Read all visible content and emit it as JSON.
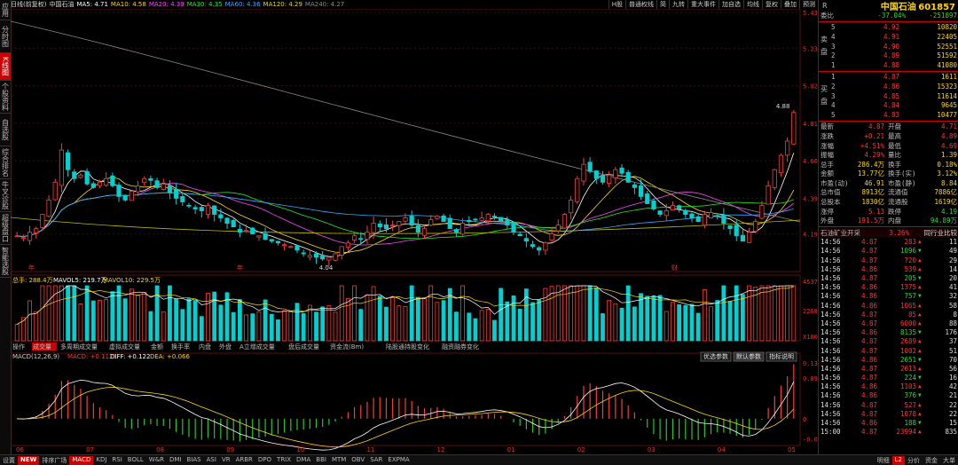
{
  "left_tabs": [
    "应用",
    "分时图",
    "K线图",
    "个股资料",
    "自选股",
    "综合排名",
    "牛叉诊股",
    "超级盘口",
    "智能选股"
  ],
  "header": {
    "period_label": "日线(前复权)",
    "stock_label": "中国石油",
    "ma": [
      {
        "label": "MA5: 4.71",
        "color": "#ffffff"
      },
      {
        "label": "MA10: 4.58",
        "color": "#ffd700"
      },
      {
        "label": "MA20: 4.39",
        "color": "#ff44ff"
      },
      {
        "label": "MA30: 4.35",
        "color": "#22ee22"
      },
      {
        "label": "MA60: 4.36",
        "color": "#33aaff"
      },
      {
        "label": "MA120: 4.29",
        "color": "#dddd00"
      },
      {
        "label": "MA240: 4.27",
        "color": "#888888"
      }
    ],
    "tools": [
      "H股",
      "普通权线",
      "简",
      "九转",
      "重大事件",
      "加自选",
      "均线",
      "复权",
      "叠加",
      "预测"
    ]
  },
  "price_axis": [
    "5.43",
    "5.23",
    "5.02",
    "4.81",
    "4.60",
    "4.39",
    "4.19"
  ],
  "price_annotations": {
    "high": "4.88",
    "low": "4.04"
  },
  "volume_axis": {
    "top": "45370",
    "mid": "22685",
    "unit": "X100"
  },
  "volume_legend": {
    "label": "总手: 288.4万",
    "mavol5": "MAVOL5: 219.7万",
    "mavol10": "MAVOL10: 229.5万"
  },
  "sub_tabs": [
    "操作",
    "成交量",
    "多周期成交量",
    "虚拟成交量",
    "金额",
    "换手率",
    "内盘",
    "外盘",
    "A立增成交量",
    "盘后成交量",
    "资金流(Bm)",
    "陆股通持股变化",
    "融资融券变化"
  ],
  "macd_legend": {
    "label": "MACD(12,26,9)",
    "macd": "MACD: +0.1121",
    "diff": "DIFF: +0.122",
    "dea": "DEA: +0.066"
  },
  "macd_buttons": [
    "优选参数",
    "默认参数",
    "指标说明"
  ],
  "macd_axis": [
    "0.134",
    "0.097",
    "0",
    "-0.048"
  ],
  "time_axis": [
    "06",
    "07",
    "08",
    "09",
    "10",
    "11",
    "12",
    "01",
    "02",
    "03",
    "04",
    "05"
  ],
  "month_markers": [
    "年",
    "年",
    "财"
  ],
  "bottom_tabs": [
    "设置",
    "NEW",
    "排序广场",
    "MACD",
    "KDJ",
    "RSI",
    "BOLL",
    "W&R",
    "DMI",
    "BIAS",
    "ASI",
    "VR",
    "ARBR",
    "DPO",
    "TRIX",
    "DMA",
    "BBI",
    "MTM",
    "OBV",
    "SAR",
    "EXPMA"
  ],
  "bottom_right_tabs": [
    "明细",
    "L2",
    "分价",
    "资金",
    "大单"
  ],
  "stock": {
    "name": "中国石油",
    "code": "601857",
    "badge": "R"
  },
  "weibi": {
    "label": "委比",
    "pct": "-37.04%",
    "diff": "-251897"
  },
  "sell_orders": [
    {
      "level": "5",
      "price": "4.92",
      "vol": "10820"
    },
    {
      "level": "4",
      "price": "4.91",
      "vol": "22405"
    },
    {
      "level": "3",
      "price": "4.90",
      "vol": "52551"
    },
    {
      "level": "2",
      "price": "4.89",
      "vol": "51592"
    },
    {
      "level": "1",
      "price": "4.88",
      "vol": "41080"
    }
  ],
  "buy_orders": [
    {
      "level": "1",
      "price": "4.87",
      "vol": "1611"
    },
    {
      "level": "2",
      "price": "4.86",
      "vol": "15323"
    },
    {
      "level": "3",
      "price": "4.85",
      "vol": "11614"
    },
    {
      "level": "4",
      "price": "4.84",
      "vol": "9645"
    },
    {
      "level": "5",
      "price": "4.83",
      "vol": "10477"
    }
  ],
  "sell_side_label": "卖盘",
  "buy_side_label": "买盘",
  "quote": [
    [
      "最新",
      "4.87",
      "开盘",
      "4.71"
    ],
    [
      "涨跌",
      "+0.21",
      "最高",
      "4.89"
    ],
    [
      "涨幅",
      "+4.51%",
      "最低",
      "4.69"
    ],
    [
      "振幅",
      "4.29%",
      "量比",
      "1.39"
    ],
    [
      "总手",
      "286.4万",
      "换手",
      "0.18%"
    ],
    [
      "金额",
      "13.77亿",
      "换手(实)",
      "3.12%"
    ],
    [
      "市盈(动)",
      "46.91",
      "市盈(静)",
      "8.84"
    ],
    [
      "总市值",
      "8913亿",
      "流通值",
      "7886亿"
    ],
    [
      "总股本",
      "1830亿",
      "流通股",
      "1619亿"
    ],
    [
      "涨停",
      "5.13",
      "跌停",
      "4.19"
    ],
    [
      "外盘",
      "191.5万",
      "内盘",
      "94.89万"
    ]
  ],
  "industry": {
    "label": "石油矿业开采",
    "pct": "3.26%",
    "link": "同行业比较"
  },
  "ticks": [
    [
      "14:56",
      "4.87",
      "283",
      "11"
    ],
    [
      "14:56",
      "4.87",
      "1096",
      "49"
    ],
    [
      "14:56",
      "4.87",
      "720",
      "29"
    ],
    [
      "14:56",
      "4.86",
      "539",
      "14"
    ],
    [
      "14:56",
      "4.87",
      "205",
      "20"
    ],
    [
      "14:56",
      "4.86",
      "1375",
      "41"
    ],
    [
      "14:56",
      "4.86",
      "757",
      "32"
    ],
    [
      "14:56",
      "4.86",
      "1065",
      "58"
    ],
    [
      "14:56",
      "4.87",
      "85",
      "8"
    ],
    [
      "14:56",
      "4.87",
      "6000",
      "88"
    ],
    [
      "14:56",
      "4.86",
      "8135",
      "176"
    ],
    [
      "14:56",
      "4.87",
      "2689",
      "37"
    ],
    [
      "14:56",
      "4.87",
      "1002",
      "51"
    ],
    [
      "14:56",
      "4.86",
      "2651",
      "70"
    ],
    [
      "14:56",
      "4.87",
      "2613",
      "56"
    ],
    [
      "14:56",
      "4.87",
      "224",
      "16"
    ],
    [
      "14:56",
      "4.86",
      "1103",
      "42"
    ],
    [
      "14:56",
      "4.86",
      "376",
      "21"
    ],
    [
      "14:56",
      "4.87",
      "527",
      "22"
    ],
    [
      "14:56",
      "4.87",
      "1078",
      "22"
    ],
    [
      "14:56",
      "4.86",
      "188",
      "15"
    ],
    [
      "15:00",
      "4.87",
      "23994",
      "835"
    ]
  ],
  "tick_dirs": [
    "up",
    "down",
    "up",
    "up",
    "down",
    "up",
    "down",
    "up",
    "up",
    "up",
    "down",
    "up",
    "up",
    "down",
    "up",
    "down",
    "up",
    "down",
    "up",
    "up",
    "down",
    "up"
  ],
  "chart_data": {
    "type": "candlestick",
    "note_price_range": [
      4.0,
      5.43
    ],
    "closes": [
      4.18,
      4.17,
      4.2,
      4.22,
      4.3,
      4.38,
      4.48,
      4.66,
      4.55,
      4.5,
      4.52,
      4.47,
      4.45,
      4.48,
      4.5,
      4.46,
      4.4,
      4.38,
      4.43,
      4.46,
      4.5,
      4.49,
      4.45,
      4.47,
      4.42,
      4.39,
      4.37,
      4.35,
      4.33,
      4.32,
      4.35,
      4.3,
      4.28,
      4.25,
      4.23,
      4.2,
      4.21,
      4.19,
      4.18,
      4.16,
      4.15,
      4.14,
      4.13,
      4.12,
      4.1,
      4.08,
      4.07,
      4.06,
      4.05,
      4.06,
      4.08,
      4.12,
      4.14,
      4.18,
      4.16,
      4.2,
      4.25,
      4.23,
      4.22,
      4.24,
      4.26,
      4.28,
      4.24,
      4.2,
      4.22,
      4.27,
      4.29,
      4.26,
      4.22,
      4.2,
      4.25,
      4.26,
      4.27,
      4.28,
      4.3,
      4.29,
      4.26,
      4.24,
      4.2,
      4.18,
      4.15,
      4.12,
      4.1,
      4.14,
      4.19,
      4.24,
      4.3,
      4.38,
      4.5,
      4.58,
      4.54,
      4.5,
      4.48,
      4.52,
      4.55,
      4.53,
      4.48,
      4.45,
      4.4,
      4.36,
      4.33,
      4.3,
      4.32,
      4.35,
      4.33,
      4.3,
      4.28,
      4.26,
      4.3,
      4.31,
      4.29,
      4.25,
      4.22,
      4.18,
      4.15,
      4.2,
      4.26,
      4.35,
      4.46,
      4.55,
      4.63,
      4.71,
      4.87
    ]
  }
}
